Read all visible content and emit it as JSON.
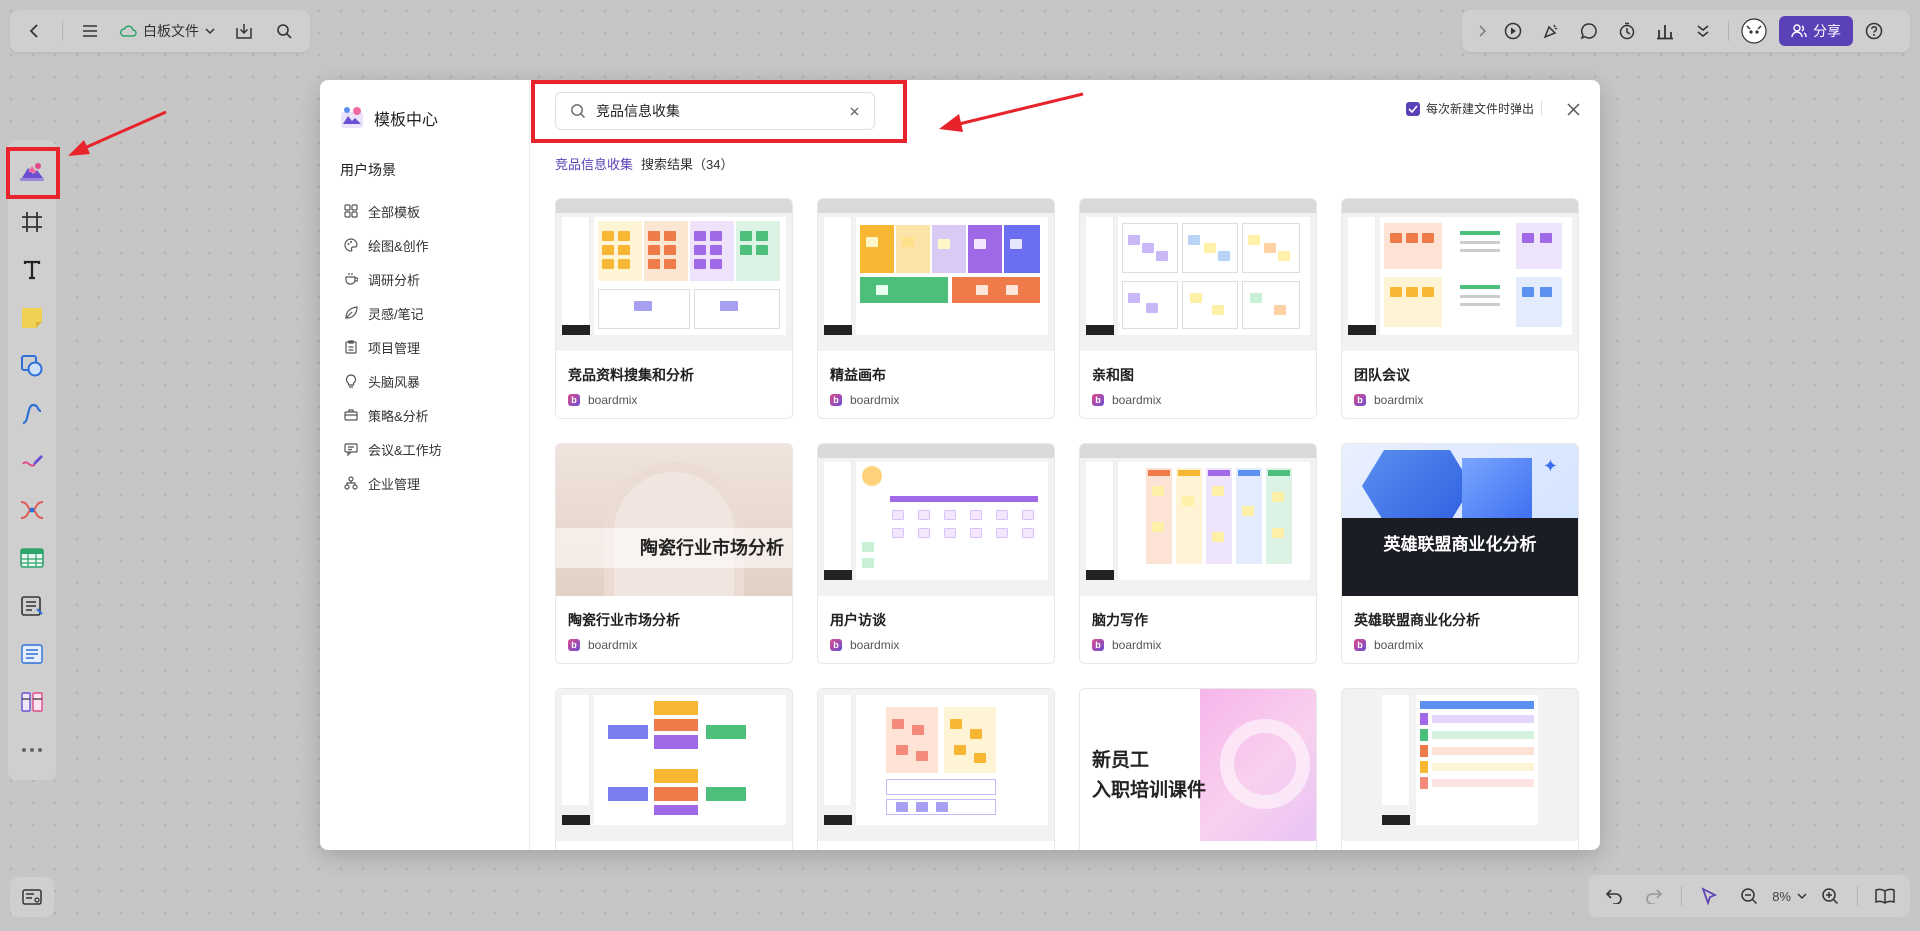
{
  "topbar": {
    "file_label": "白板文件",
    "share_label": "分享"
  },
  "bottombar": {
    "zoom": "8%"
  },
  "modal": {
    "title": "模板中心",
    "section_title": "用户场景",
    "categories": [
      {
        "label": "全部模板",
        "icon": "grid-icon"
      },
      {
        "label": "绘图&创作",
        "icon": "palette-icon"
      },
      {
        "label": "调研分析",
        "icon": "cup-icon"
      },
      {
        "label": "灵感/笔记",
        "icon": "leaf-icon"
      },
      {
        "label": "项目管理",
        "icon": "clipboard-icon"
      },
      {
        "label": "头脑风暴",
        "icon": "bulb-icon"
      },
      {
        "label": "策略&分析",
        "icon": "briefcase-icon"
      },
      {
        "label": "会议&工作坊",
        "icon": "chat-icon"
      },
      {
        "label": "企业管理",
        "icon": "org-icon"
      }
    ],
    "search": {
      "value": "竞品信息收集",
      "keyword": "竞品信息收集",
      "result_text": "搜索结果（34）"
    },
    "popup_option": "每次新建文件时弹出",
    "cards": [
      {
        "title": "竞品资料搜集和分析",
        "author": "boardmix"
      },
      {
        "title": "精益画布",
        "author": "boardmix"
      },
      {
        "title": "亲和图",
        "author": "boardmix"
      },
      {
        "title": "团队会议",
        "author": "boardmix"
      },
      {
        "title": "陶瓷行业市场分析",
        "author": "boardmix",
        "thumb_text": "陶瓷行业市场分析"
      },
      {
        "title": "用户访谈",
        "author": "boardmix"
      },
      {
        "title": "脑力写作",
        "author": "boardmix"
      },
      {
        "title": "英雄联盟商业化分析",
        "author": "boardmix",
        "thumb_text": "英雄联盟商业化分析"
      },
      {
        "title": "",
        "author": ""
      },
      {
        "title": "",
        "author": ""
      },
      {
        "title": "",
        "author": "",
        "thumb_text": "新员工",
        "thumb_text2": "入职培训课件"
      },
      {
        "title": "",
        "author": ""
      }
    ]
  },
  "colors": {
    "accent": "#5b41b8",
    "annotation_red": "#e8232b"
  }
}
